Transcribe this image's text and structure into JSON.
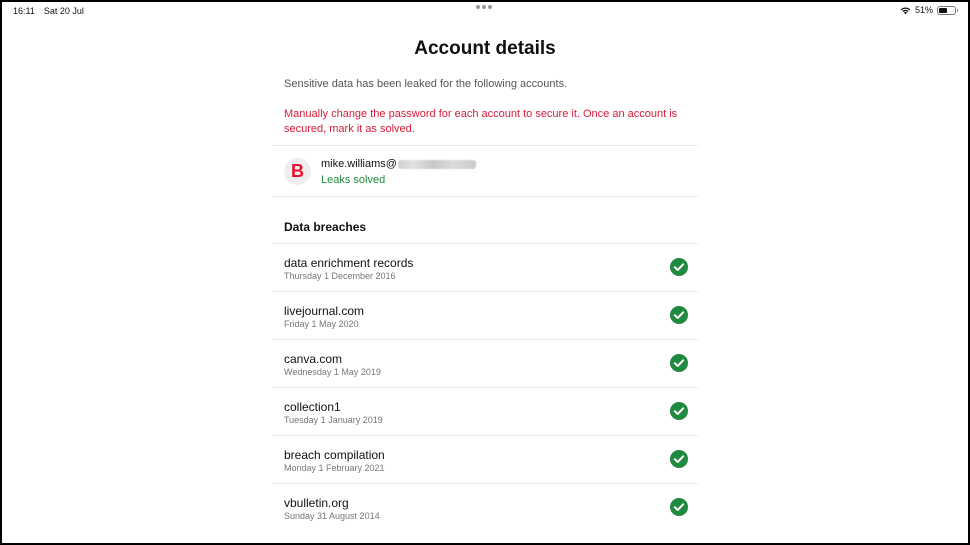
{
  "status_bar": {
    "time": "16:11",
    "date": "Sat 20 Jul",
    "battery_percent": "51%",
    "battery_level": 0.51,
    "wifi_icon": "wifi-icon"
  },
  "page": {
    "title": "Account details",
    "intro": "Sensitive data has been leaked for the following accounts.",
    "warning": "Manually change the password for each account to secure it. Once an account is secured, mark it as solved."
  },
  "account": {
    "avatar_letter": "B",
    "email_prefix": "mike.williams@",
    "status": "Leaks solved"
  },
  "breaches": {
    "heading": "Data breaches",
    "items": [
      {
        "name": "data enrichment records",
        "date": "Thursday 1 December 2016",
        "solved": true
      },
      {
        "name": "livejournal.com",
        "date": "Friday 1 May 2020",
        "solved": true
      },
      {
        "name": "canva.com",
        "date": "Wednesday 1 May 2019",
        "solved": true
      },
      {
        "name": "collection1",
        "date": "Tuesday 1 January 2019",
        "solved": true
      },
      {
        "name": "breach compilation",
        "date": "Monday 1 February 2021",
        "solved": true
      },
      {
        "name": "vbulletin.org",
        "date": "Sunday 31 August 2014",
        "solved": true
      }
    ]
  },
  "colors": {
    "warning": "#d81b3a",
    "success": "#1f8a3e",
    "brand": "#e8102c"
  }
}
